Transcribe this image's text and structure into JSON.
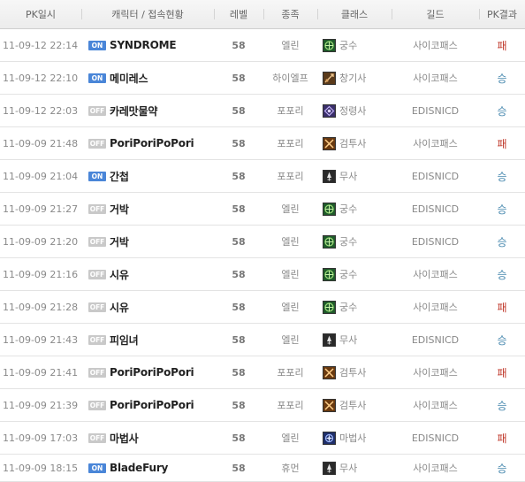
{
  "header": {
    "date": "PK일시",
    "character": "캐릭터 / 접속현황",
    "level": "레벨",
    "race": "종족",
    "class": "클래스",
    "guild": "길드",
    "result": "PK결과"
  },
  "rows": [
    {
      "date": "11-09-12 22:14",
      "status": "ON",
      "name": "SYNDROME",
      "level": "58",
      "race": "엘린",
      "class": "궁수",
      "class_icon": "archer-icon",
      "guild": "사이코패스",
      "result": "패"
    },
    {
      "date": "11-09-12 22:10",
      "status": "ON",
      "name": "메미레스",
      "level": "58",
      "race": "하이엘프",
      "class": "창기사",
      "class_icon": "lancer-icon",
      "guild": "사이코패스",
      "result": "승"
    },
    {
      "date": "11-09-12 22:03",
      "status": "OFF",
      "name": "카레맛물약",
      "level": "58",
      "race": "포포리",
      "class": "정령사",
      "class_icon": "elementalist-icon",
      "guild": "EDISNICD",
      "result": "승"
    },
    {
      "date": "11-09-09 21:48",
      "status": "OFF",
      "name": "PoriPoriPoPori",
      "level": "58",
      "race": "포포리",
      "class": "검투사",
      "class_icon": "gladiator-icon",
      "guild": "사이코패스",
      "result": "패"
    },
    {
      "date": "11-09-09 21:04",
      "status": "ON",
      "name": "간첩",
      "level": "58",
      "race": "포포리",
      "class": "무사",
      "class_icon": "warrior-icon",
      "guild": "EDISNICD",
      "result": "승"
    },
    {
      "date": "11-09-09 21:27",
      "status": "OFF",
      "name": "거박",
      "level": "58",
      "race": "엘린",
      "class": "궁수",
      "class_icon": "archer-icon",
      "guild": "EDISNICD",
      "result": "승"
    },
    {
      "date": "11-09-09 21:20",
      "status": "OFF",
      "name": "거박",
      "level": "58",
      "race": "엘린",
      "class": "궁수",
      "class_icon": "archer-icon",
      "guild": "EDISNICD",
      "result": "승"
    },
    {
      "date": "11-09-09 21:16",
      "status": "OFF",
      "name": "시유",
      "level": "58",
      "race": "엘린",
      "class": "궁수",
      "class_icon": "archer-icon",
      "guild": "사이코패스",
      "result": "승"
    },
    {
      "date": "11-09-09 21:28",
      "status": "OFF",
      "name": "시유",
      "level": "58",
      "race": "엘린",
      "class": "궁수",
      "class_icon": "archer-icon",
      "guild": "사이코패스",
      "result": "패"
    },
    {
      "date": "11-09-09 21:43",
      "status": "OFF",
      "name": "피임녀",
      "level": "58",
      "race": "엘린",
      "class": "무사",
      "class_icon": "warrior-icon",
      "guild": "EDISNICD",
      "result": "승"
    },
    {
      "date": "11-09-09 21:41",
      "status": "OFF",
      "name": "PoriPoriPoPori",
      "level": "58",
      "race": "포포리",
      "class": "검투사",
      "class_icon": "gladiator-icon",
      "guild": "사이코패스",
      "result": "패"
    },
    {
      "date": "11-09-09 21:39",
      "status": "OFF",
      "name": "PoriPoriPoPori",
      "level": "58",
      "race": "포포리",
      "class": "검투사",
      "class_icon": "gladiator-icon",
      "guild": "사이코패스",
      "result": "승"
    },
    {
      "date": "11-09-09 17:03",
      "status": "OFF",
      "name": "마법사",
      "level": "58",
      "race": "엘린",
      "class": "마법사",
      "class_icon": "sorcerer-icon",
      "guild": "EDISNICD",
      "result": "패"
    },
    {
      "date": "11-09-09 18:15",
      "status": "ON",
      "name": "BladeFury",
      "level": "58",
      "race": "휴먼",
      "class": "무사",
      "class_icon": "warrior-icon",
      "guild": "사이코패스",
      "result": "승"
    }
  ],
  "colors": {
    "on_badge": "#4a86d8",
    "off_badge": "#c9c9c9",
    "win": "#4a8ab0",
    "lose": "#c0392b"
  }
}
